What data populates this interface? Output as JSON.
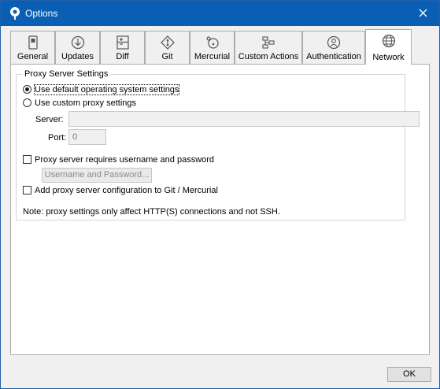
{
  "window": {
    "title": "Options"
  },
  "tabs": [
    {
      "label": "General",
      "icon": "phone-icon"
    },
    {
      "label": "Updates",
      "icon": "download-icon"
    },
    {
      "label": "Diff",
      "icon": "diff-icon"
    },
    {
      "label": "Git",
      "icon": "git-icon"
    },
    {
      "label": "Mercurial",
      "icon": "mercurial-icon"
    },
    {
      "label": "Custom Actions",
      "icon": "custom-actions-icon"
    },
    {
      "label": "Authentication",
      "icon": "user-icon"
    },
    {
      "label": "Network",
      "icon": "globe-icon"
    }
  ],
  "active_tab": "Network",
  "proxy": {
    "group_title": "Proxy Server Settings",
    "use_default_label": "Use default operating system settings",
    "use_custom_label": "Use custom proxy settings",
    "server_label": "Server:",
    "server_value": "",
    "port_label": "Port:",
    "port_value": "0",
    "requires_auth_label": "Proxy server requires username and password",
    "credentials_button_label": "Username and Password...",
    "add_config_label": "Add proxy server configuration to Git / Mercurial",
    "note": "Note: proxy settings only affect HTTP(S) connections and not SSH."
  },
  "footer": {
    "ok_label": "OK"
  }
}
